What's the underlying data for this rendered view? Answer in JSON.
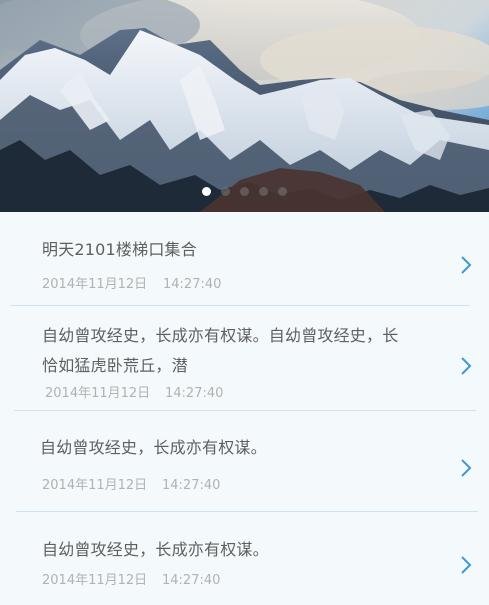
{
  "banner": {
    "image_name": "snow-mountain-banner",
    "slide_count": 5,
    "active_slide": 1
  },
  "items": [
    {
      "title_lines": [
        "明天2101楼梯口集合"
      ],
      "date": "2014年11月12日",
      "time": "14:27:40"
    },
    {
      "title_lines": [
        "自幼曾攻经史，长成亦有权谋。自幼曾攻经史，长",
        "恰如猛虎卧荒丘，潜"
      ],
      "date": "2014年11月12日",
      "time": "14:27:40"
    },
    {
      "title_lines": [
        "自幼曾攻经史，长成亦有权谋。"
      ],
      "date": "2014年11月12日",
      "time": "14:27:40"
    },
    {
      "title_lines": [
        "自幼曾攻经史，长成亦有权谋。"
      ],
      "date": "2014年11月12日",
      "time": "14:27:40"
    }
  ],
  "colors": {
    "chevron": "#3d9ad6",
    "divider": "#cfe3ef",
    "background": "#f4f9fc"
  }
}
